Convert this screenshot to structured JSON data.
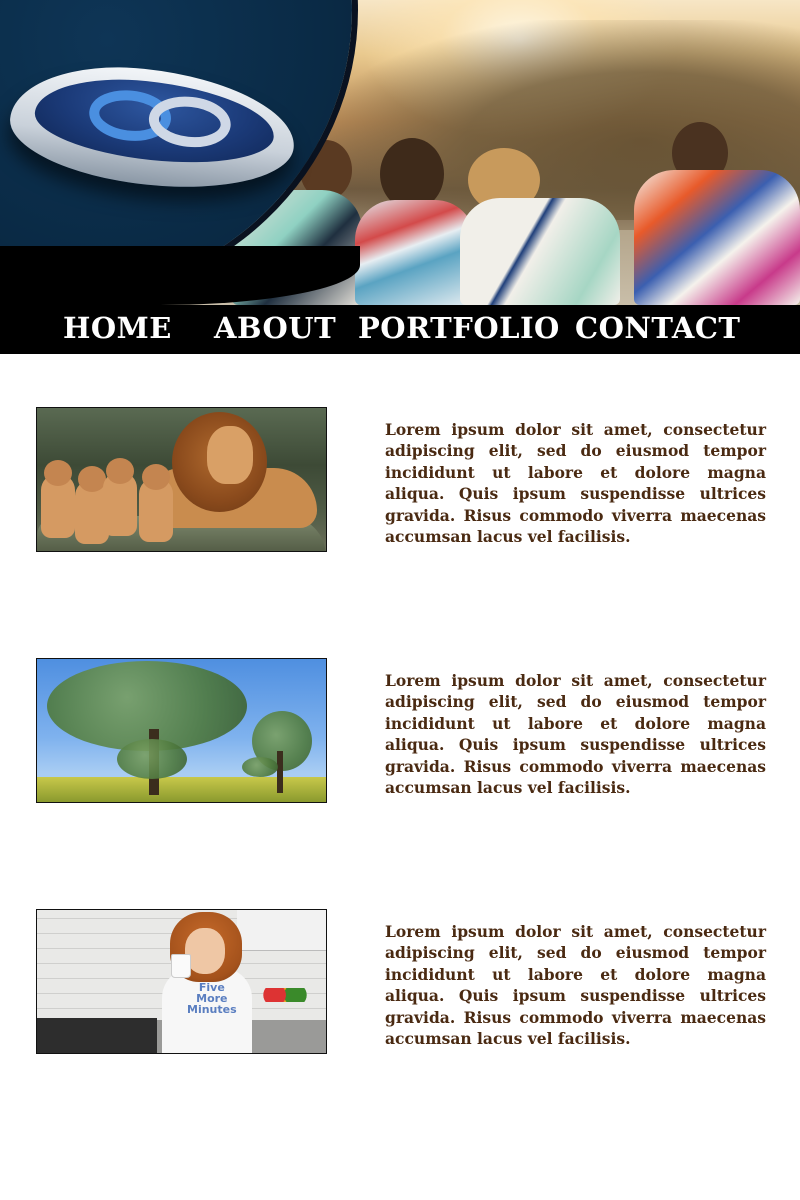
{
  "nav": {
    "home": "HOME",
    "about": "ABOUT",
    "portfolio": "PORTFOLIO",
    "contact": "CONTACT"
  },
  "hero": {
    "logo_icon": "fedora-infinity-icon"
  },
  "items": [
    {
      "image": "lion-with-cubs-photo",
      "text": "Lorem ipsum dolor sit amet, consectetur adipiscing elit, sed do eiusmod tempor incididunt ut labore et dolore magna aliqua. Quis ipsum suspendisse ultrices gravida. Risus commodo viverra maecenas accumsan lacus vel facilisis."
    },
    {
      "image": "trees-in-field-photo",
      "text": "Lorem ipsum dolor sit amet, consectetur adipiscing elit, sed do eiusmod tempor incididunt ut labore et dolore magna aliqua. Quis ipsum suspendisse ultrices gravida. Risus commodo viverra maecenas accumsan lacus vel facilisis."
    },
    {
      "image": "woman-drinking-coffee-photo",
      "shirt_text": "Five More Minutes",
      "text": "Lorem ipsum dolor sit amet, consectetur adipiscing elit, sed do eiusmod tempor incididunt ut labore et dolore magna aliqua. Quis ipsum suspendisse ultrices gravida. Risus commodo viverra maecenas accumsan lacus vel facilisis."
    }
  ],
  "colors": {
    "nav_bg": "#000000",
    "nav_text": "#ffffff",
    "body_text": "#4a2a12"
  }
}
